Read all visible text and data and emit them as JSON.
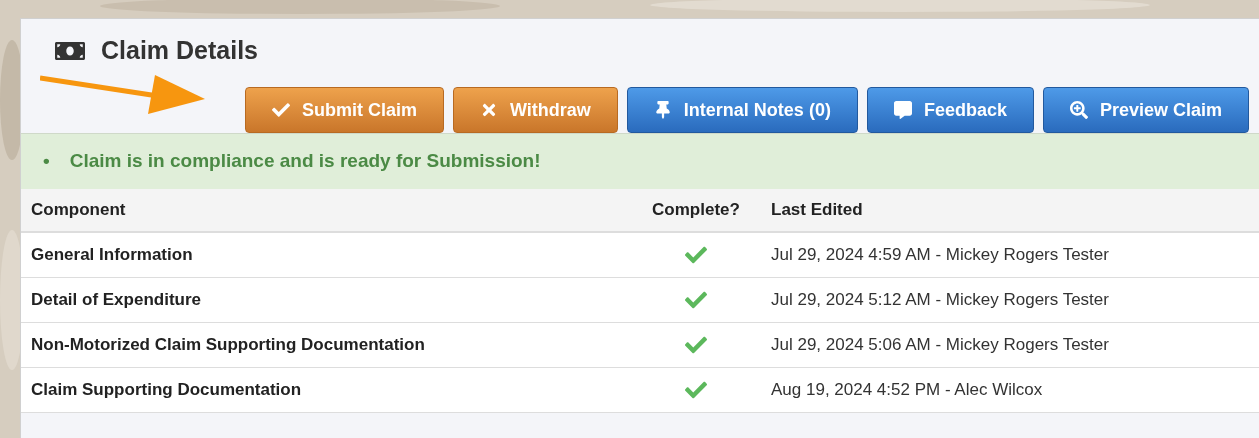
{
  "title": "Claim Details",
  "buttons": [
    {
      "label": "Submit Claim",
      "kind": "warning"
    },
    {
      "label": "Withdraw",
      "kind": "warning"
    },
    {
      "label": "Internal Notes (0)",
      "kind": "primary"
    },
    {
      "label": "Feedback",
      "kind": "primary"
    },
    {
      "label": "Preview Claim",
      "kind": "primary"
    }
  ],
  "alert": {
    "bullet": "•",
    "text": "Claim is in compliance and is ready for Submission!"
  },
  "table": {
    "columns": [
      "Component",
      "Complete?",
      "Last Edited"
    ],
    "rows": [
      {
        "component": "General Information",
        "complete": true,
        "last_edited": "Jul 29, 2024 4:59 AM - Mickey Rogers Tester"
      },
      {
        "component": "Detail of Expenditure",
        "complete": true,
        "last_edited": "Jul 29, 2024 5:12 AM - Mickey Rogers Tester"
      },
      {
        "component": "Non-Motorized Claim Supporting Documentation",
        "complete": true,
        "last_edited": "Jul 29, 2024 5:06 AM - Mickey Rogers Tester"
      },
      {
        "component": "Claim Supporting Documentation",
        "complete": true,
        "last_edited": "Aug 19, 2024 4:52 PM - Alec Wilcox"
      }
    ]
  }
}
